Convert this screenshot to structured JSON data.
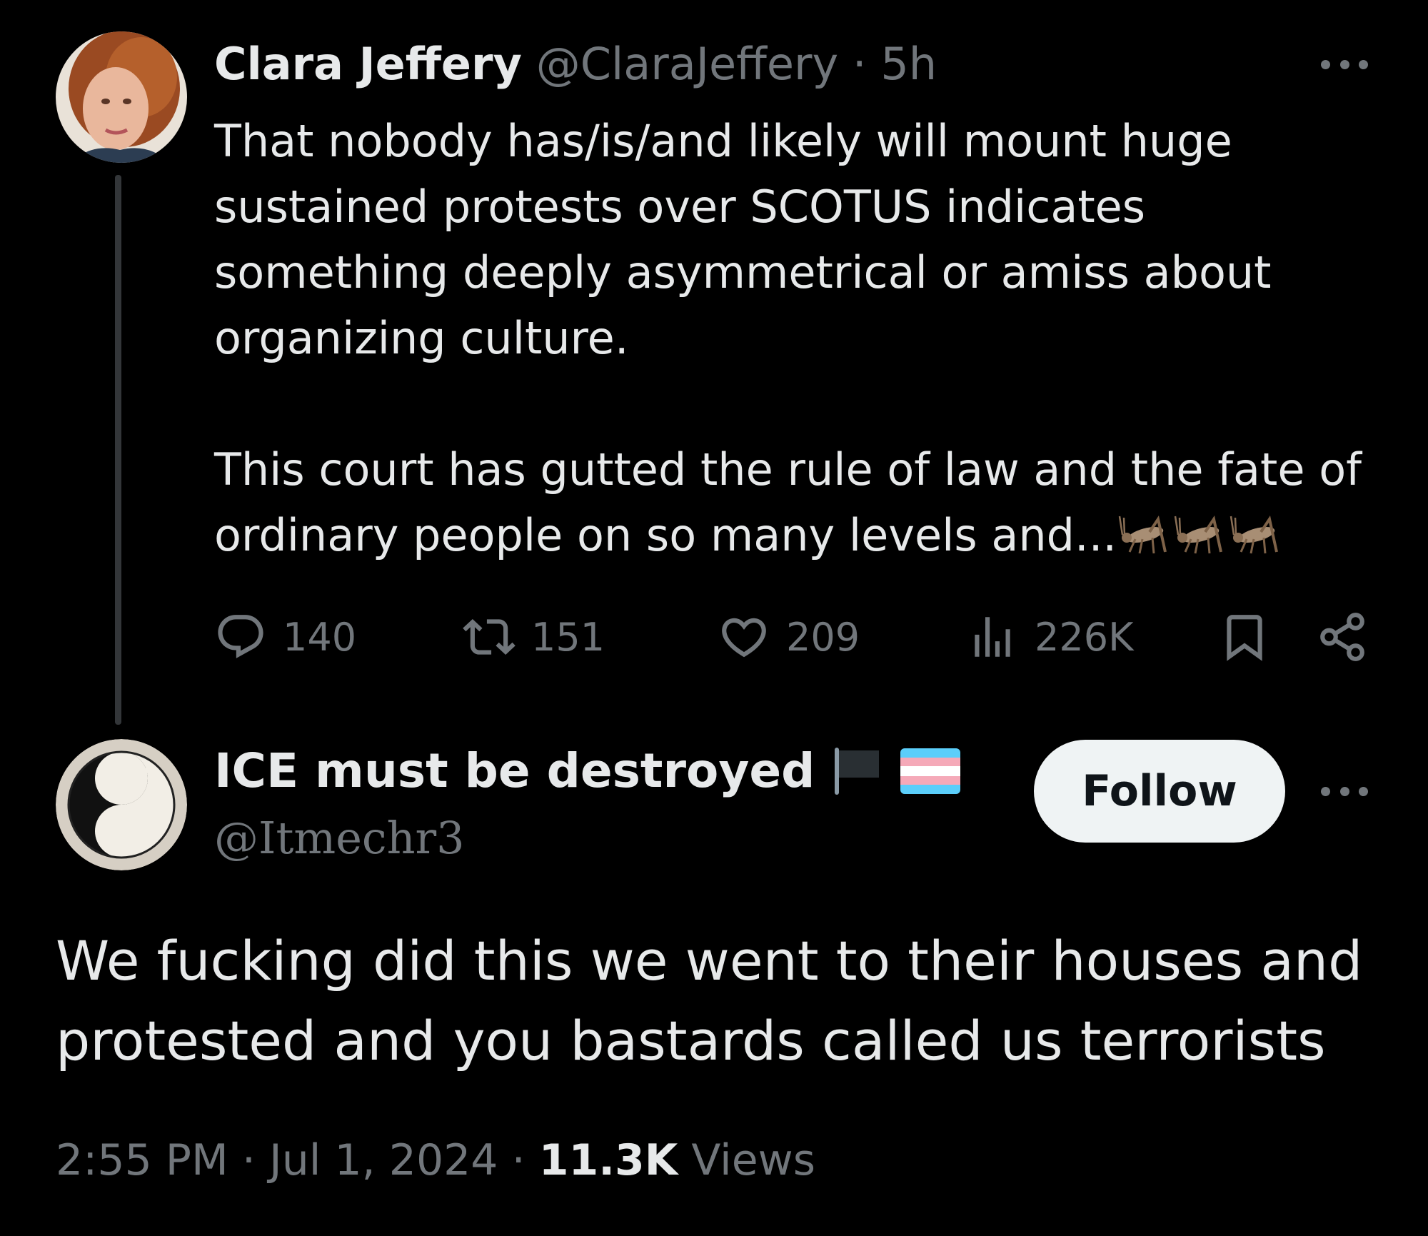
{
  "parent_tweet": {
    "author_name": "Clara Jeffery",
    "author_handle": "@ClaraJeffery",
    "separator": "·",
    "time_ago": "5h",
    "text_paragraph_1": [
      "That nobody has/is/and likely will mount huge",
      "sustained protests over SCOTUS indicates",
      "something deeply asymmetrical or amiss about",
      "organizing culture."
    ],
    "text_paragraph_2": [
      "This court has gutted the rule of law and the fate of",
      "ordinary people on so many levels and..."
    ],
    "trailing_emoji": [
      "cricket-icon",
      "cricket-icon",
      "cricket-icon"
    ],
    "stats": {
      "replies": "140",
      "retweets": "151",
      "likes": "209",
      "views": "226K"
    }
  },
  "reply_tweet": {
    "author_name": "ICE must be destroyed",
    "name_emoji": [
      "black-flag-icon",
      "transgender-flag-icon"
    ],
    "author_handle": "@Itmechr3",
    "follow_label": "Follow",
    "text": [
      "We fucking did this we went to their houses and",
      "protested and you bastards called us terrorists"
    ],
    "time": "2:55 PM",
    "separator": "·",
    "date": "Jul 1, 2024",
    "views_count": "11.3K",
    "views_label": "Views"
  },
  "colors": {
    "background": "#000000",
    "primary_text": "#e7e9ea",
    "secondary_text": "#71767b",
    "thread_line": "#333639",
    "follow_button_bg": "#eff3f4"
  }
}
